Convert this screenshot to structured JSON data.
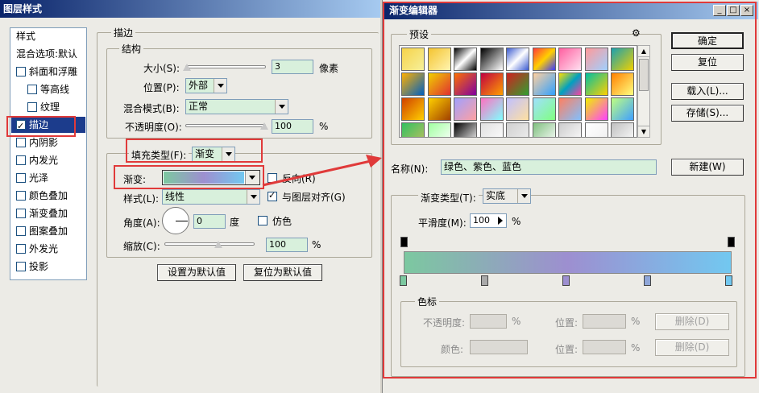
{
  "layer_style": {
    "title": "图层样式",
    "sidebar": {
      "items": [
        {
          "label": "样式",
          "checkbox": false
        },
        {
          "label": "混合选项:默认",
          "checkbox": false
        },
        {
          "label": "斜面和浮雕",
          "checkbox": true,
          "checked": false
        },
        {
          "label": "等高线",
          "checkbox": true,
          "checked": false
        },
        {
          "label": "纹理",
          "checkbox": true,
          "checked": false
        },
        {
          "label": "描边",
          "checkbox": true,
          "checked": true
        },
        {
          "label": "内阴影",
          "checkbox": true,
          "checked": false
        },
        {
          "label": "内发光",
          "checkbox": true,
          "checked": false
        },
        {
          "label": "光泽",
          "checkbox": true,
          "checked": false
        },
        {
          "label": "颜色叠加",
          "checkbox": true,
          "checked": false
        },
        {
          "label": "渐变叠加",
          "checkbox": true,
          "checked": false
        },
        {
          "label": "图案叠加",
          "checkbox": true,
          "checked": false
        },
        {
          "label": "外发光",
          "checkbox": true,
          "checked": false
        },
        {
          "label": "投影",
          "checkbox": true,
          "checked": false
        }
      ]
    },
    "stroke": {
      "group_title": "描边",
      "structure_title": "结构",
      "size_label": "大小(S):",
      "size_value": "3",
      "size_unit": "像素",
      "position_label": "位置(P):",
      "position_value": "外部",
      "blend_label": "混合模式(B):",
      "blend_value": "正常",
      "opacity_label": "不透明度(O):",
      "opacity_value": "100",
      "opacity_unit": "%",
      "fill_type_label": "填充类型(F):",
      "fill_type_value": "渐变",
      "gradient_label": "渐变:",
      "reverse_label": "反向(R)",
      "style_label": "样式(L):",
      "style_value": "线性",
      "align_label": "与图层对齐(G)",
      "angle_label": "角度(A):",
      "angle_value": "0",
      "angle_unit": "度",
      "dither_label": "仿色",
      "scale_label": "缩放(C):",
      "scale_value": "100",
      "scale_unit": "%",
      "set_default_label": "设置为默认值",
      "reset_default_label": "复位为默认值"
    }
  },
  "gradient_editor": {
    "title": "渐变编辑器",
    "presets_label": "预设",
    "ok_label": "确定",
    "reset_label": "复位",
    "load_label": "载入(L)...",
    "save_label": "存储(S)...",
    "name_label": "名称(N):",
    "name_value": "绿色、紫色、蓝色",
    "new_label": "新建(W)",
    "gradient_type_label": "渐变类型(T):",
    "gradient_type_value": "实底",
    "smoothness_label": "平滑度(M):",
    "smoothness_value": "100",
    "smoothness_unit": "%",
    "stops_label": "色标",
    "opacity_label": "不透明度:",
    "opacity_unit": "%",
    "position_label": "位置:",
    "position_unit": "%",
    "delete_label": "删除(D)",
    "color_label": "颜色:",
    "gradient_colors": [
      "#7cc8a0",
      "#9d8fd0",
      "#72c8f0"
    ]
  }
}
